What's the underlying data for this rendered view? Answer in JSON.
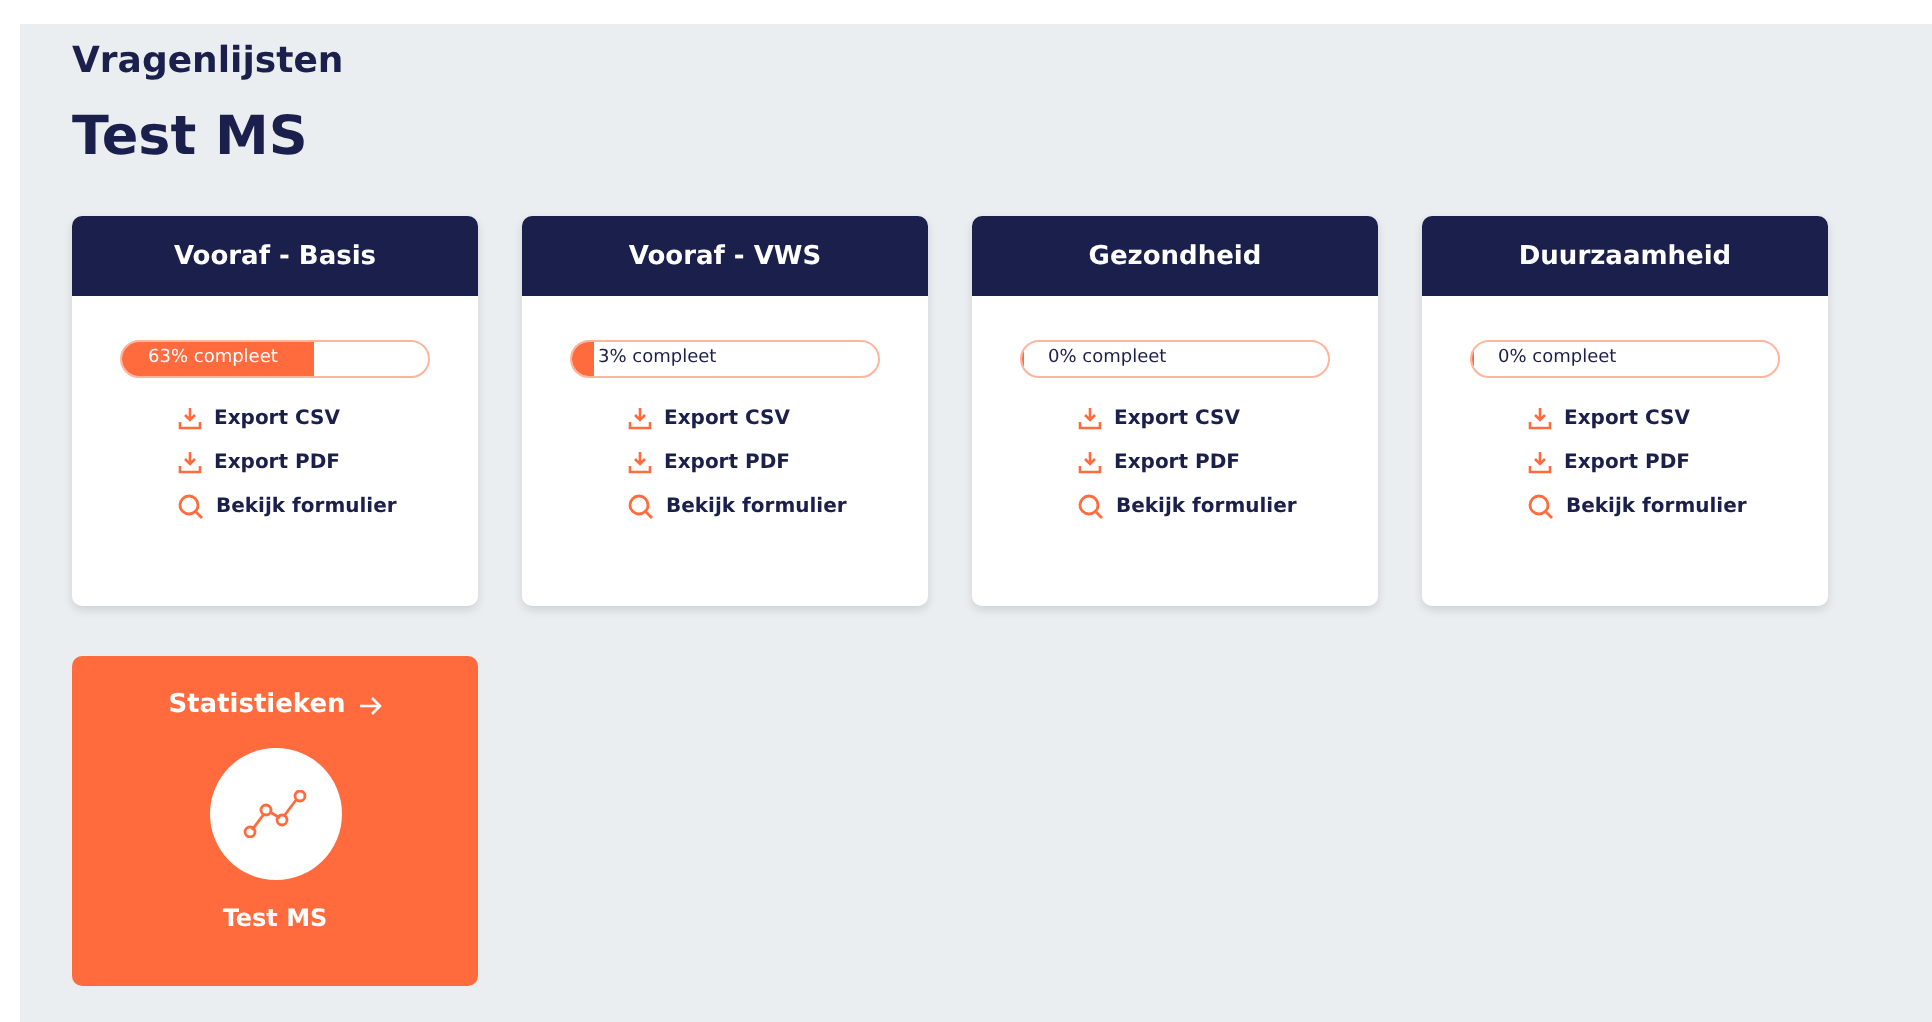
{
  "breadcrumb": "Vragenlijsten",
  "title": "Test MS",
  "cards": [
    {
      "title": "Vooraf - Basis",
      "progress": {
        "level": 0.63,
        "label": "63% compleet"
      },
      "actions": [
        {
          "kind": "download",
          "label": "Export CSV"
        },
        {
          "kind": "download",
          "label": "Export PDF"
        },
        {
          "kind": "search",
          "label": "Bekijk formulier"
        }
      ]
    },
    {
      "title": "Vooraf - VWS",
      "progress": {
        "level": 0.07,
        "label": "3% compleet"
      },
      "actions": [
        {
          "kind": "download",
          "label": "Export CSV"
        },
        {
          "kind": "download",
          "label": "Export PDF"
        },
        {
          "kind": "search",
          "label": "Bekijk formulier"
        }
      ]
    },
    {
      "title": "Gezondheid",
      "progress": {
        "level": 0,
        "label": "0% compleet"
      },
      "actions": [
        {
          "kind": "download",
          "label": "Export CSV"
        },
        {
          "kind": "download",
          "label": "Export PDF"
        },
        {
          "kind": "search",
          "label": "Bekijk formulier"
        }
      ]
    },
    {
      "title": "Duurzaamheid",
      "progress": {
        "level": 0,
        "label": "0% compleet"
      },
      "actions": [
        {
          "kind": "download",
          "label": "Export CSV"
        },
        {
          "kind": "download",
          "label": "Export PDF"
        },
        {
          "kind": "search",
          "label": "Bekijk formulier"
        }
      ]
    }
  ],
  "stats": {
    "link": "Statistieken",
    "name": "Test MS"
  }
}
